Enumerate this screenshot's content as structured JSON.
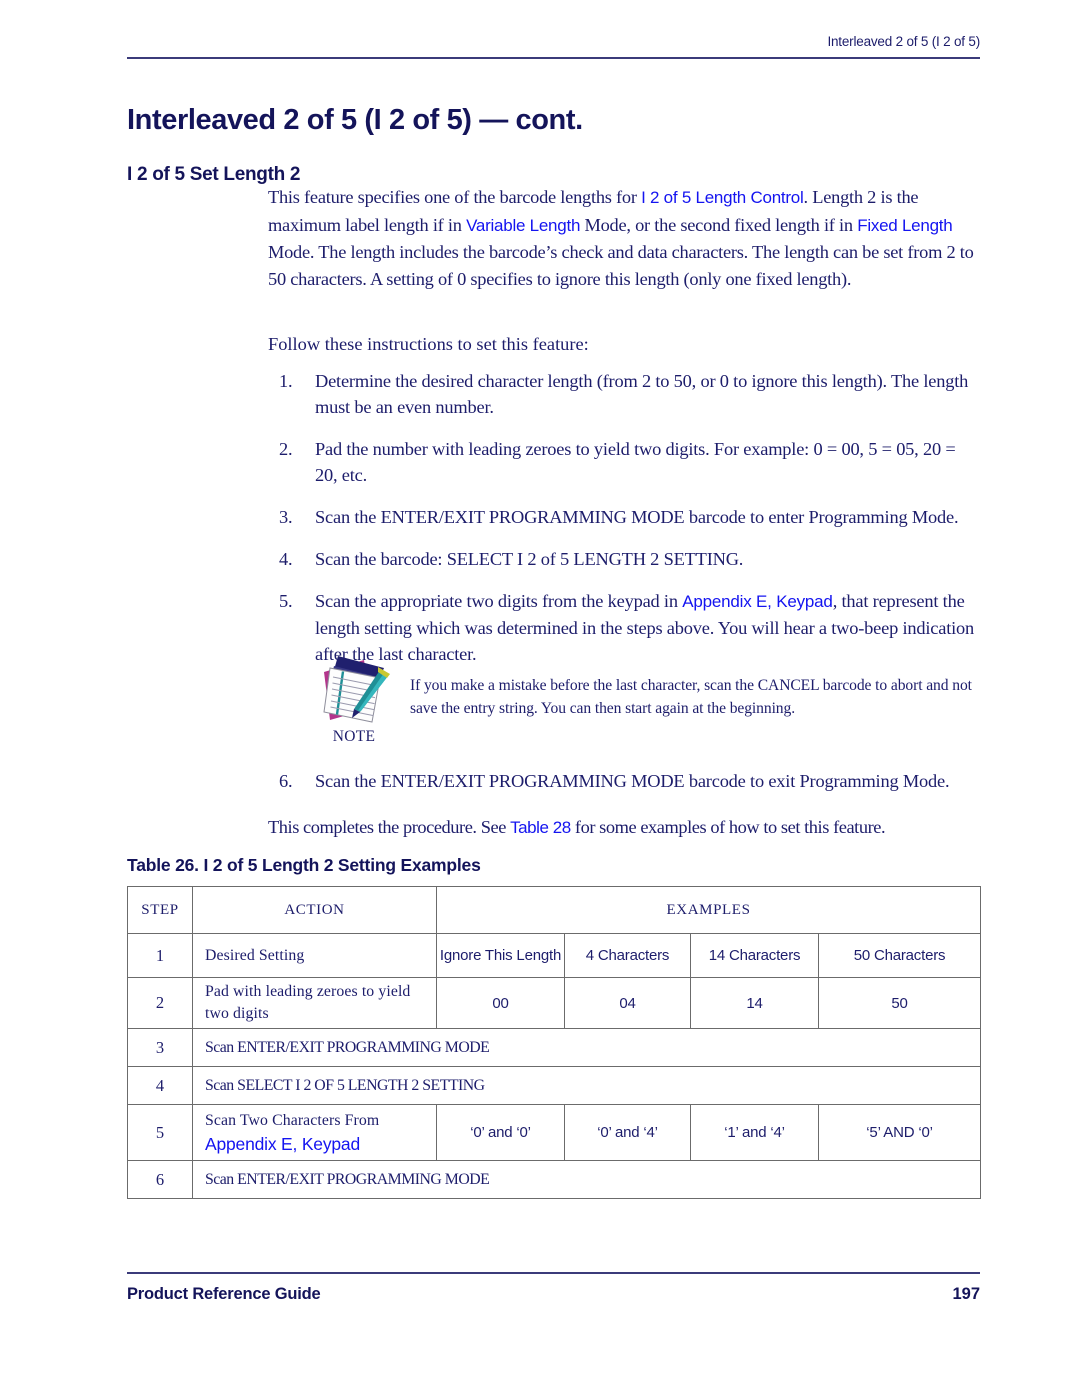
{
  "page": {
    "running_header": "Interleaved 2 of 5 (I 2 of 5)",
    "chapter_title": "Interleaved 2 of 5 (I 2 of 5) — cont.",
    "section_title": "I 2 of 5 Set Length 2",
    "footer_left": "Product Reference Guide",
    "footer_page_number": "197",
    "rule_color": "#3b3b7a",
    "text_color": "#1d1d6b",
    "link_color": "#1414f0",
    "heading_color": "#14145a"
  },
  "intro": {
    "p1_a": "This feature specifies one of the barcode lengths for ",
    "p1_link1": "I 2 of 5 Length Control",
    "p1_b": ". Length 2 is the maximum label length if in ",
    "p1_link2": "Variable Length",
    "p1_c": " Mode, or the second fixed length if in ",
    "p1_link3": "Fixed Length",
    "p1_d": " Mode. The length includes the barcode’s check and data characters. The length can be set from 2 to 50 characters. A setting of 0 specifies to ignore this length (only one fixed length).",
    "follow_line": "Follow these instructions to set this feature:"
  },
  "steps": [
    {
      "num": "1.",
      "text": "Determine the desired character length (from 2 to 50, or 0 to ignore this length). The length must be an even number."
    },
    {
      "num": "2.",
      "text": "Pad the number with leading zeroes to yield two digits. For example: 0 = 00, 5 = 05, 20 = 20, etc."
    },
    {
      "num": "3.",
      "text": "Scan the ENTER/EXIT PROGRAMMING MODE barcode to enter Programming Mode."
    },
    {
      "num": "4.",
      "text": "Scan the barcode: SELECT I 2 of 5 LENGTH 2 SETTING."
    },
    {
      "num": "5.",
      "text_a": "Scan the appropriate two digits from the keypad in ",
      "link": "Appendix E, Keypad",
      "text_b": ", that represent the length setting which was determined in the steps above. You will hear a two-beep indication after the last character."
    }
  ],
  "note": {
    "label": "NOTE",
    "icon": "notepad-pen-icon",
    "text": "If you make a mistake before the last character, scan the CANCEL barcode to abort and not save the entry string. You can then start again at the beginning."
  },
  "step6": {
    "num": "6.",
    "text": "Scan the ENTER/EXIT PROGRAMMING MODE barcode to exit Programming Mode."
  },
  "completes": {
    "a": "This completes the procedure. See ",
    "link": "Table 28",
    "b": " for some examples of how to set this feature."
  },
  "table": {
    "caption": "Table 26. I 2 of 5 Length 2 Setting Examples",
    "headers": {
      "step": "STEP",
      "action": "ACTION",
      "examples": "EXAMPLES"
    },
    "rows": [
      {
        "step": "1",
        "action": "Desired Setting",
        "action_link": "",
        "span": false,
        "examples": [
          "Ignore This Length",
          "4 Characters",
          "14 Characters",
          "50 Characters"
        ]
      },
      {
        "step": "2",
        "action": "Pad with leading zeroes to yield two digits",
        "action_link": "",
        "span": false,
        "examples": [
          "00",
          "04",
          "14",
          "50"
        ]
      },
      {
        "step": "3",
        "action": "Scan ENTER/EXIT PROGRAMMING MODE",
        "action_link": "",
        "span": true,
        "examples": []
      },
      {
        "step": "4",
        "action": "Scan SELECT I 2 OF 5 LENGTH 2 SETTING",
        "action_link": "",
        "span": true,
        "examples": []
      },
      {
        "step": "5",
        "action": "Scan Two Characters From",
        "action_link": "Appendix E, Keypad",
        "span": false,
        "examples": [
          "‘0’ and ‘0’",
          "‘0’ and ‘4’",
          "‘1’ and ‘4’",
          "‘5’ AND ‘0’"
        ]
      },
      {
        "step": "6",
        "action": "Scan ENTER/EXIT PROGRAMMING MODE",
        "action_link": "",
        "span": true,
        "examples": []
      }
    ]
  }
}
